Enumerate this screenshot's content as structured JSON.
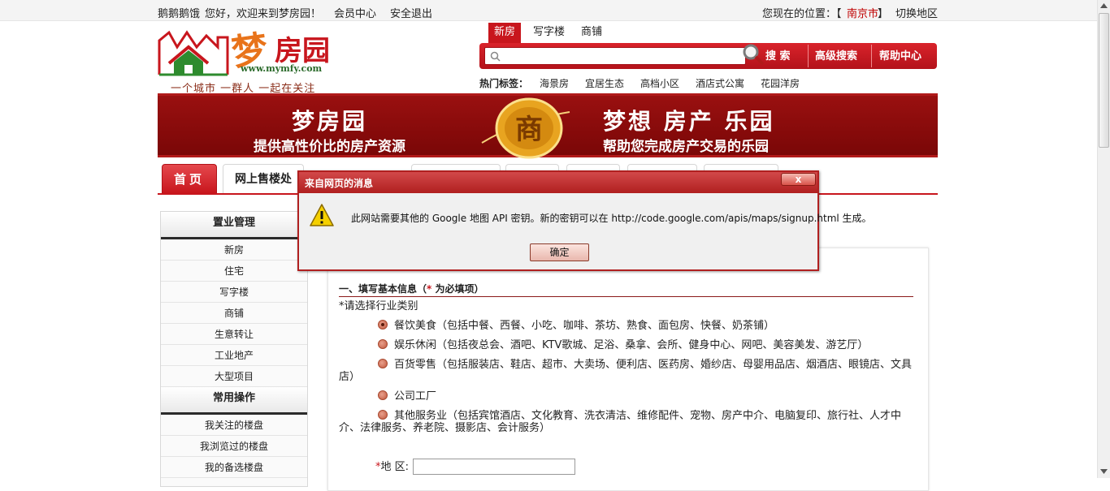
{
  "topbar": {
    "user": "鹅鹅鹅饿",
    "greeting": "您好，欢迎来到梦房园！",
    "member_center": "会员中心",
    "logout": "安全退出",
    "location_label": "您现在的位置：【",
    "city": "南京市",
    "location_close": "】",
    "switch_region": "切换地区"
  },
  "logo": {
    "name": "梦房园",
    "url": "www.mymfy.com",
    "slogan": "一个城市  一群人  一起在关注"
  },
  "search": {
    "tabs": [
      "新房",
      "写字楼",
      "商铺"
    ],
    "active_tab": "新房",
    "placeholder": "",
    "search_button": "搜 索",
    "advanced_search": "高级搜索",
    "help_center": "帮助中心",
    "hot_label": "热门标签：",
    "hot_tags": [
      "海景房",
      "宜居生态",
      "高档小区",
      "酒店式公寓",
      "花园洋房"
    ]
  },
  "banner": {
    "left_title": "梦房园",
    "left_sub": "提供高性价比的房产资源",
    "coin_char": "商",
    "right_title": "梦想 房产 乐园",
    "right_sub": "帮助您完成房产交易的乐园"
  },
  "nav": {
    "home": "首页",
    "current": "网上售楼处"
  },
  "sidebar": {
    "section1_title": "置业管理",
    "section1_items": [
      "新房",
      "住宅",
      "写字楼",
      "商铺",
      "生意转让",
      "工业地产",
      "大型项目"
    ],
    "section2_title": "常用操作",
    "section2_items": [
      "我关注的楼盘",
      "我浏览过的楼盘",
      "我的备选楼盘"
    ]
  },
  "form": {
    "section_title_prefix": "一、填写基本信息（",
    "required_mark": "*",
    "section_title_suffix": " 为必填项）",
    "industry_label": "*请选择行业类别",
    "options": [
      {
        "text": "餐饮美食（包括中餐、西餐、小吃、咖啡、茶坊、熟食、面包房、快餐、奶茶铺）",
        "selected": true
      },
      {
        "text": "娱乐休闲（包括夜总会、酒吧、KTV歌城、足浴、桑拿、会所、健身中心、网吧、美容美发、游艺厅）",
        "selected": false
      },
      {
        "text": "百货零售（包括服装店、鞋店、超市、大卖场、便利店、医药房、婚纱店、母婴用品店、烟酒店、眼镜店、文具",
        "wrap": "店）",
        "selected": false
      },
      {
        "text": "公司工厂",
        "selected": false
      },
      {
        "text": "其他服务业（包括宾馆酒店、文化教育、洗衣清洁、维修配件、宠物、房产中介、电脑复印、旅行社、人才中",
        "wrap": "介、法律服务、养老院、摄影店、会计服务）",
        "selected": false
      }
    ],
    "region_label": "地  区:",
    "region_value": ""
  },
  "dialog": {
    "title": "来自网页的消息",
    "close": "x",
    "message": "此网站需要其他的 Google 地图 API 密钥。新的密钥可以在 http://code.google.com/apis/maps/signup.html 生成。",
    "ok": "确定"
  }
}
